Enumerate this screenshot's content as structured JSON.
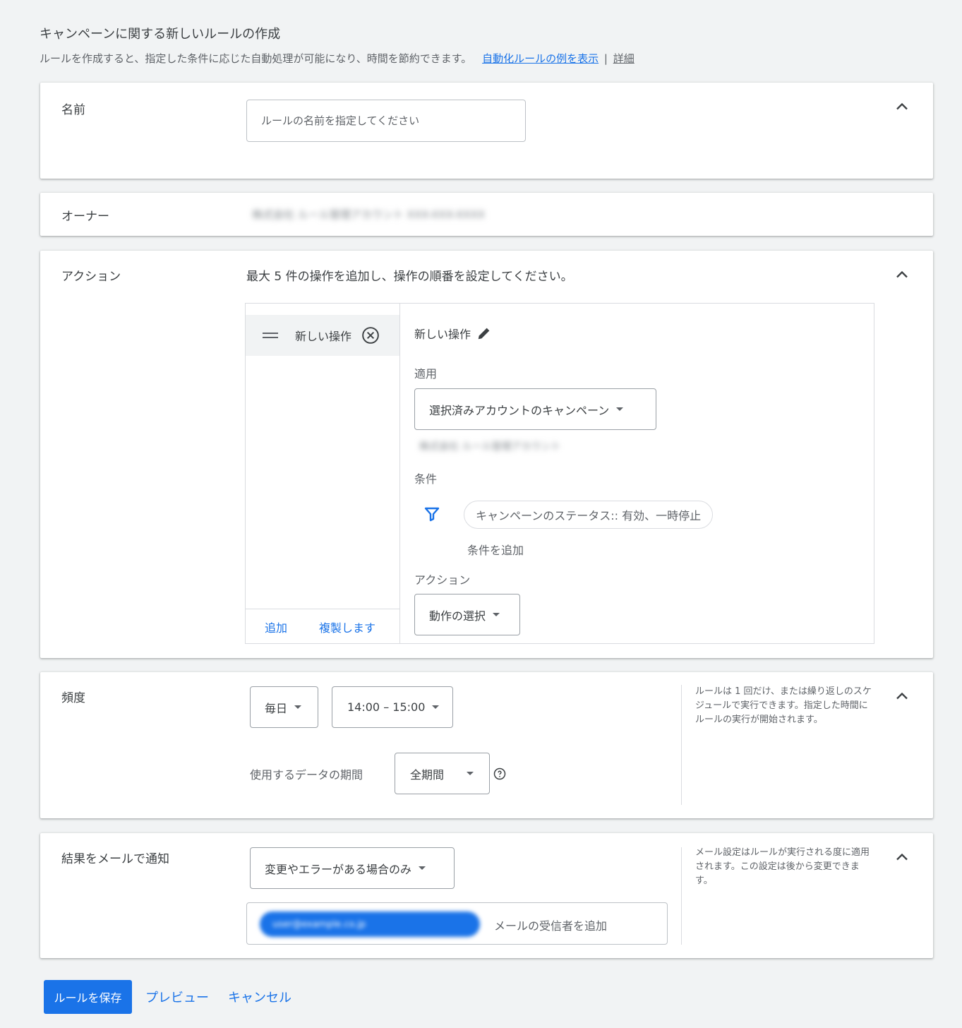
{
  "header": {
    "title": "キャンペーンに関する新しいルールの作成",
    "subtitle": "ルールを作成すると、指定した条件に応じた自動処理が可能になり、時間を節約できます。",
    "example_link": "自動化ルールの例を表示",
    "separator": "|",
    "details_link": "詳細"
  },
  "name_section": {
    "label": "名前",
    "placeholder": "ルールの名前を指定してください"
  },
  "owner_section": {
    "label": "オーナー",
    "value": "株式会社 ルール管理アカウント XXX-XXX-XXXX"
  },
  "action_section": {
    "label": "アクション",
    "instruction": "最大 5 件の操作を追加し、操作の順番を設定してください。",
    "operations": [
      {
        "label": "新しい操作"
      }
    ],
    "add_button": "追加",
    "duplicate_button": "複製します",
    "detail": {
      "title": "新しい操作",
      "apply_label": "適用",
      "apply_value": "選択済みアカウントのキャンペーン",
      "apply_account": "株式会社 ルール管理アカウント",
      "condition_label": "条件",
      "condition_chip": "キャンペーンのステータス:: 有効、一時停止",
      "add_condition": "条件を追加",
      "action_label": "アクション",
      "action_select": "動作の選択"
    }
  },
  "frequency_section": {
    "label": "頻度",
    "frequency_value": "毎日",
    "time_value": "14:00 – 15:00",
    "data_period_label": "使用するデータの期間",
    "data_period_value": "全期間",
    "note": "ルールは 1 回だけ、または繰り返しのスケジュールで実行できます。指定した時間にルールの実行が開始されます。"
  },
  "email_section": {
    "label": "結果をメールで通知",
    "notify_value": "変更やエラーがある場合のみ",
    "recipient_chip": "user@example.co.jp",
    "add_recipient_placeholder": "メールの受信者を追加",
    "note": "メール設定はルールが実行される度に適用されます。この設定は後から変更できます。"
  },
  "footer": {
    "save_button": "ルールを保存",
    "preview_button": "プレビュー",
    "cancel_button": "キャンセル"
  },
  "colors": {
    "accent": "#1a73e8",
    "background": "#f1f3f4",
    "card": "#ffffff"
  }
}
